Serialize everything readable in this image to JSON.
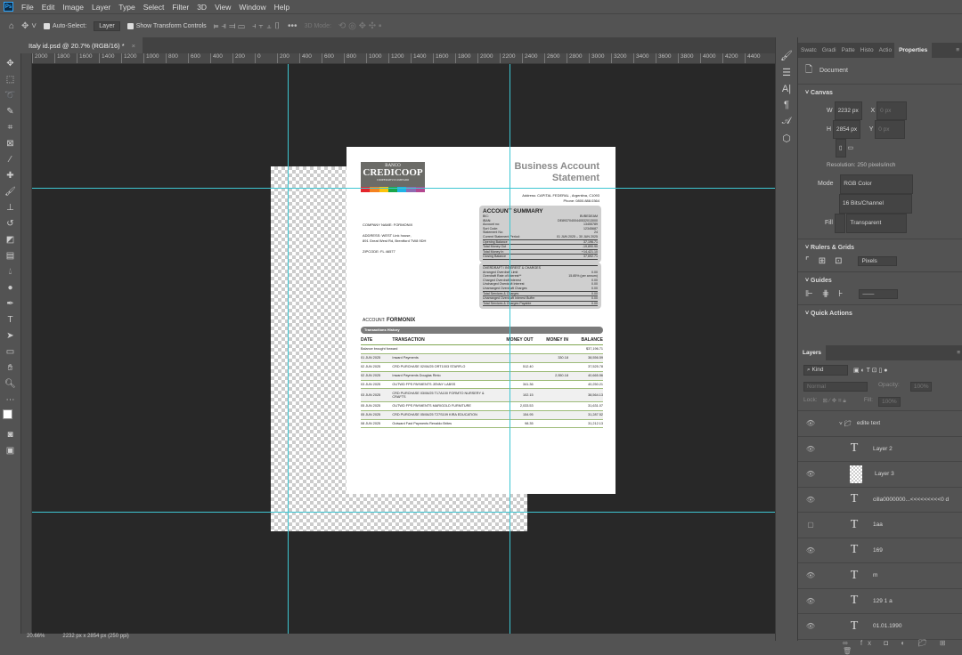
{
  "menu": [
    "File",
    "Edit",
    "Image",
    "Layer",
    "Type",
    "Select",
    "Filter",
    "3D",
    "View",
    "Window",
    "Help"
  ],
  "options": {
    "auto_select": "Auto-Select:",
    "auto_select_value": "Layer",
    "show_transform": "Show Transform Controls",
    "mode_3d": "3D Mode:"
  },
  "doc_tab": {
    "title": "Italy id.psd @ 20.7% (RGB/16) *",
    "close": "×"
  },
  "ruler": [
    "2000",
    "1800",
    "1600",
    "1400",
    "1200",
    "1000",
    "800",
    "600",
    "400",
    "200",
    "0",
    "200",
    "400",
    "600",
    "800",
    "1000",
    "1200",
    "1400",
    "1600",
    "1800",
    "2000",
    "2200",
    "2400",
    "2600",
    "2800",
    "3000",
    "3200",
    "3400",
    "3600",
    "3800",
    "4000",
    "4200",
    "4400"
  ],
  "status": {
    "zoom": "20.66%",
    "info": "2232 px x 2854 px (250 ppi)"
  },
  "document": {
    "logo": {
      "top": "BANCO",
      "name": "CREDICOOP",
      "sub": "COOPERATIVO LIMITADO",
      "colors": [
        "#e4252c",
        "#f58220",
        "#fcc30b",
        "#1aa64a",
        "#1fb3e6",
        "#8e6bb1",
        "#b3478f"
      ]
    },
    "title1": "Business Account",
    "title2": "Statement",
    "address": "Address: CAPITAL FEDERAL , Argentina, C1093",
    "phone": "Phone: 0800.888.0364",
    "company": "COMPANY NAME: FORMONIX",
    "addr1": "ADDRESS: WEST Link house,",
    "addr2": "891 Great West Rd, Brentford TW8 9DH",
    "zip": "ZIPCODE: FL 46577",
    "summary": {
      "heading": "ACCOUNT SUMMARY",
      "rows": [
        [
          "BIC:",
          "BVBEDEAM"
        ],
        [
          "IBAN:",
          "DE89370400440532013000"
        ],
        [
          "Account no:",
          "13455789"
        ],
        [
          "Sort Code:",
          "12345687"
        ],
        [
          "Statement No:",
          "24"
        ],
        [
          "Current Statement Period:",
          "01 JUN 2025 – 30 JUN 2025"
        ],
        [
          "Opening Balance",
          "37,196.71"
        ],
        [
          "Total Money Out",
          "-19,890.90"
        ],
        [
          "Total Money In",
          "+14,421.10"
        ],
        [
          "Closing Balance",
          "37,692.71"
        ]
      ]
    },
    "overdraft": {
      "heading": "OVERDRAFT / INTEREST & CHARGES",
      "rows": [
        [
          "Arranged Overdraft Limit",
          "0.00"
        ],
        [
          "Overdraft Rate of Interest**",
          "15.85% (per annum)"
        ],
        [
          "Charged Overdraft Interest",
          "0.00"
        ],
        [
          "Uncharged Overdraft Interest",
          "0.00"
        ],
        [
          "Unarranged Overdraft Charges",
          "0.00"
        ],
        [
          "Total Services & Charges",
          "0.00"
        ],
        [
          "Unarranged Overdraft Interest Buffer",
          "0.00"
        ],
        [
          "Total Services & Charges Payable",
          "0.00"
        ]
      ]
    },
    "account_label": "ACCOUNT:",
    "account_name": "FORMONIX",
    "history_label": "Transactions History",
    "columns": [
      "DATE",
      "TRANSACTION",
      "MONEY OUT",
      "MONEY IN",
      "BALANCE"
    ],
    "rows": [
      [
        "Balance brought forward",
        "",
        "",
        "",
        "$37,196.71"
      ],
      [
        "01 JUN 2025",
        "Inward Payments",
        "",
        "330.18",
        "38,556.59"
      ],
      [
        "02 JUN 2025",
        "CRD PURCHASE 02/06/25 ORT1003 STARFLO",
        "512.40",
        "",
        "37,525.78"
      ],
      [
        "02 JUN 2025",
        "Inward Payments Douglas Rinto",
        "",
        "2,550.18",
        "40,665.56"
      ],
      [
        "03 JUN 2025",
        "OUTWD FPS PAYMENTS JENNY LABSS",
        "341.36",
        "",
        "40,250.21"
      ],
      [
        "03 JUN 2025",
        "CRD PURCHASE 03/06/25 T17A100 FORMTO NURSERY & CRAFTS",
        "102.15",
        "",
        "38,564.13"
      ],
      [
        "05 JUN 2025",
        "OUTWD FPS PAYMENTS MARIGOLD FURNITURE",
        "2,033.53",
        "",
        "31,631.07"
      ],
      [
        "05 JUN 2025",
        "CRD PURCHASE 05/06/25 T27S109 KIRA EDUCATION",
        "154.95",
        "",
        "31,287.52"
      ],
      [
        "08 JUN 2025",
        "Outward Fast Payments Renaldo Brites",
        "98.35",
        "",
        "31,212.13"
      ]
    ]
  },
  "side_icons": [
    "brush-settings",
    "adjustments",
    "character",
    "paragraph",
    "glyphs",
    "3d"
  ],
  "properties": {
    "tabs": [
      "Swatc",
      "Gradi",
      "Patte",
      "Histo",
      "Actio",
      "Properties"
    ],
    "kind": "Document",
    "canvas": "Canvas",
    "w_label": "W",
    "w": "2232 px",
    "h_label": "H",
    "h": "2854 px",
    "x_label": "X",
    "x": "0 px",
    "y_label": "Y",
    "y": "0 px",
    "resolution": "Resolution: 250 pixels/inch",
    "mode_label": "Mode",
    "mode": "RGB Color",
    "depth": "16 Bits/Channel",
    "fill_label": "Fill",
    "fill": "Transparent",
    "rulers": "Rulers & Grids",
    "units": "Pixels",
    "guides": "Guides",
    "quick": "Quick Actions"
  },
  "layers": {
    "tab": "Layers",
    "kind": "Kind",
    "blend": "Normal",
    "opacity_label": "Opacity:",
    "opacity": "100%",
    "lock_label": "Lock:",
    "fill_label": "Fill:",
    "fill": "100%",
    "items": [
      {
        "name": "edite text",
        "type": "group",
        "visible": true
      },
      {
        "name": "Layer 2",
        "type": "text",
        "visible": true
      },
      {
        "name": "Layer 3",
        "type": "image",
        "visible": true
      },
      {
        "name": "cilla0000000...<<<<<<<<<0 d",
        "type": "text",
        "visible": true
      },
      {
        "name": "1aa",
        "type": "text",
        "visible": false
      },
      {
        "name": "169",
        "type": "text",
        "visible": true
      },
      {
        "name": "m",
        "type": "text",
        "visible": true
      },
      {
        "name": "129 1 a",
        "type": "text",
        "visible": true
      },
      {
        "name": "01.01.1990",
        "type": "text",
        "visible": true
      }
    ]
  },
  "colors": {
    "guide": "#3ec6d2",
    "ui_bg": "#535353",
    "canvas_bg": "#282828",
    "table_accent": "#7fa650"
  }
}
